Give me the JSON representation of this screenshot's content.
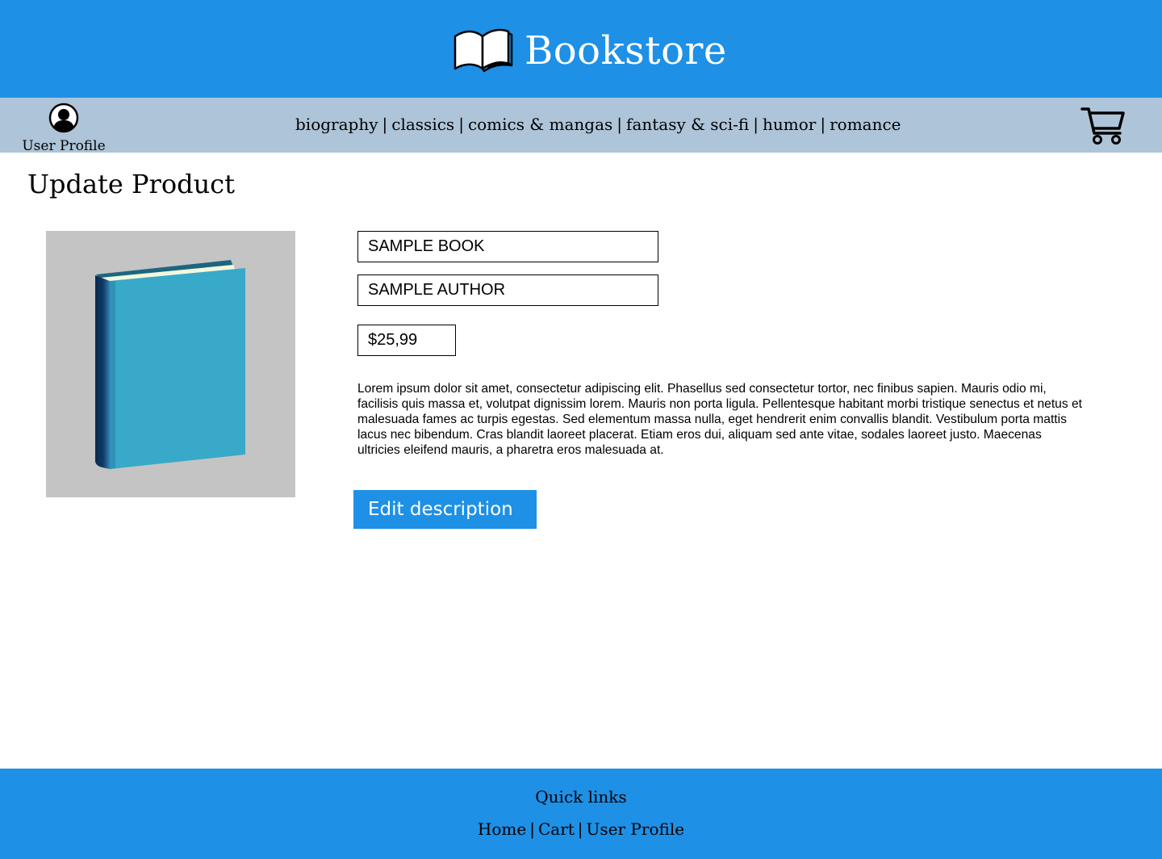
{
  "header": {
    "brand_title": "Bookstore",
    "brand_icon": "open-book-icon",
    "bg_color": "#1e90e6"
  },
  "navbar": {
    "bg_color": "#aec4d8",
    "user_profile_label": "User Profile",
    "user_icon": "user-avatar-icon",
    "categories": [
      {
        "label": "biography"
      },
      {
        "label": "classics"
      },
      {
        "label": "comics & mangas"
      },
      {
        "label": "fantasy & sci-fi"
      },
      {
        "label": "humor"
      },
      {
        "label": "romance"
      }
    ],
    "separator": "|",
    "cart_icon": "shopping-cart-icon"
  },
  "main": {
    "page_title": "Update Product",
    "cover_icon": "book-cover-image",
    "fields": {
      "title_value": "SAMPLE BOOK",
      "author_value": "SAMPLE AUTHOR",
      "price_value": "$25,99"
    },
    "description": "Lorem ipsum dolor sit amet, consectetur adipiscing elit. Phasellus sed consectetur tortor, nec finibus sapien. Mauris odio mi, facilisis quis massa et, volutpat dignissim lorem. Mauris non porta ligula. Pellentesque habitant morbi tristique senectus et netus et malesuada fames ac turpis egestas. Sed elementum massa nulla, eget hendrerit enim convallis blandit. Vestibulum porta mattis lacus nec bibendum. Cras blandit laoreet placerat. Etiam eros dui, aliquam sed ante vitae, sodales laoreet justo. Maecenas ultricies eleifend mauris, a pharetra eros malesuada at.",
    "edit_button_label": "Edit description",
    "accent_color": "#1e90e6"
  },
  "footer": {
    "title": "Quick links",
    "links": [
      {
        "label": "Home"
      },
      {
        "label": "Cart"
      },
      {
        "label": "User Profile"
      }
    ],
    "separator": "|"
  }
}
